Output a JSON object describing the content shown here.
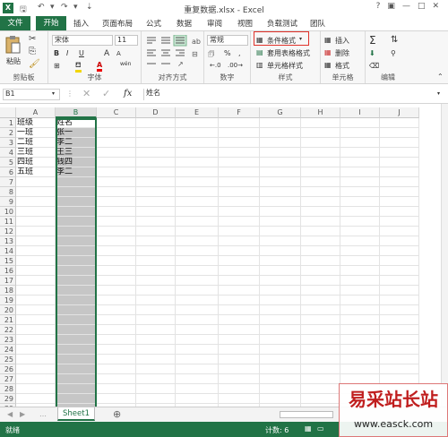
{
  "window": {
    "title": "重复数据.xlsx - Excel",
    "controls": [
      "?",
      "▣",
      "—",
      "□",
      "✕"
    ]
  },
  "tabs": {
    "file": "文件",
    "items": [
      "开始",
      "插入",
      "页面布局",
      "公式",
      "数据",
      "审阅",
      "视图",
      "负载测试",
      "团队"
    ],
    "active": "开始"
  },
  "ribbon": {
    "clipboard": {
      "label": "剪贴板",
      "paste": "粘贴"
    },
    "font": {
      "label": "字体",
      "name": "宋体",
      "size": "11",
      "bold": "B",
      "italic": "I",
      "underline": "U",
      "grow": "A",
      "shrink": "A",
      "wen": "wén"
    },
    "alignment": {
      "label": "对齐方式"
    },
    "number": {
      "label": "数字",
      "format": "常规",
      "percent": "%",
      "comma": ","
    },
    "styles": {
      "label": "样式",
      "conditional": "条件格式",
      "table": "套用表格格式",
      "cell": "单元格样式"
    },
    "cells": {
      "label": "单元格",
      "insert": "插入",
      "delete": "删除",
      "format": "格式"
    },
    "editing": {
      "label": "编辑"
    }
  },
  "formula_bar": {
    "name_box": "B1",
    "fx": "fx",
    "content": "姓名"
  },
  "columns": [
    "A",
    "B",
    "C",
    "D",
    "E",
    "F",
    "G",
    "H",
    "I",
    "J"
  ],
  "rows": [
    "1",
    "2",
    "3",
    "4",
    "5",
    "6",
    "7",
    "8",
    "9",
    "10",
    "11",
    "12",
    "13",
    "14",
    "15",
    "16",
    "17",
    "18",
    "19",
    "20",
    "21",
    "22",
    "23",
    "24",
    "25",
    "26",
    "27",
    "28",
    "29",
    "30"
  ],
  "data": {
    "A": [
      "班级",
      "一班",
      "二班",
      "三班",
      "四班",
      "五班"
    ],
    "B": [
      "姓名",
      "张一",
      "李二",
      "王三",
      "钱四",
      "李二"
    ]
  },
  "sheet": {
    "name": "Sheet1",
    "add": "⊕"
  },
  "status": {
    "ready": "就绪",
    "count": "计数: 6"
  },
  "watermark": {
    "cn": "易采站长站",
    "url": "www.easck.com"
  },
  "colors": {
    "accent": "#217346",
    "highlight": "#e0322a",
    "selection": "#c6c6c6"
  }
}
